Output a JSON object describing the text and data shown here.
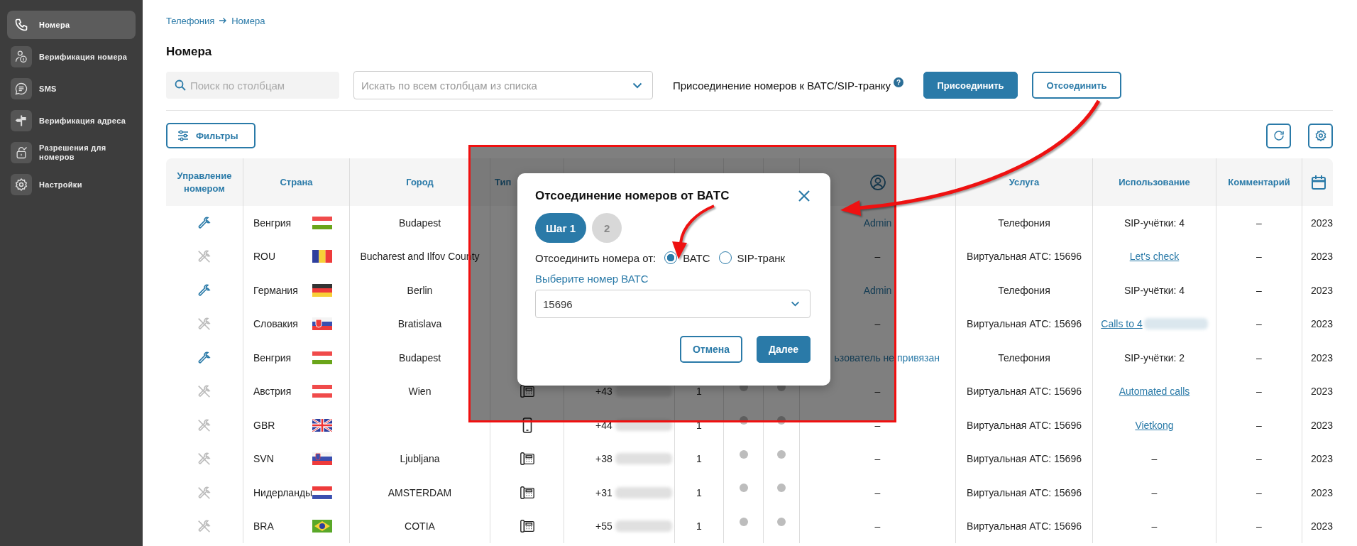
{
  "sidebar": {
    "items": [
      {
        "label": "Номера",
        "selected": true
      },
      {
        "label": "Верификация номера",
        "selected": false
      },
      {
        "label": "SMS",
        "selected": false
      },
      {
        "label": "Верификация адреса",
        "selected": false
      },
      {
        "label": "Разрешения для номеров",
        "selected": false
      },
      {
        "label": "Настройки",
        "selected": false
      }
    ]
  },
  "breadcrumb": [
    "Телефония",
    "Номера"
  ],
  "title": "Номера",
  "toolbar": {
    "search": {
      "placeholder": "Поиск по столбцам"
    },
    "column_select": {
      "placeholder": "Искать по всем столбцам из списка"
    },
    "connect_label": "Присоединение номеров к ВАТС/SIP-транку",
    "help": "?",
    "buttons": [
      {
        "label": "Присоединить",
        "kind": "primary"
      },
      {
        "label": "Отсоединить",
        "kind": "outline"
      }
    ],
    "filters": "Фильтры"
  },
  "table": {
    "columns": [
      {
        "kind": "text",
        "label": "Управление номером"
      },
      {
        "kind": "text",
        "label": "Страна"
      },
      {
        "kind": "text",
        "label": "Город"
      },
      {
        "kind": "text",
        "label": "Тип"
      },
      {
        "kind": "covered"
      },
      {
        "kind": "covered"
      },
      {
        "kind": "covered"
      },
      {
        "kind": "covered"
      },
      {
        "kind": "user-icon"
      },
      {
        "kind": "text",
        "label": "Услуга"
      },
      {
        "kind": "text",
        "label": "Использование"
      },
      {
        "kind": "text",
        "label": "Комментарий"
      },
      {
        "kind": "calendar-icon"
      }
    ],
    "rows": [
      {
        "manageable": true,
        "country": "Венгрия",
        "city": "Budapest",
        "user": {
          "text": "Admin",
          "kind": "link",
          "cut": false
        },
        "service": "Телефония",
        "usage": {
          "text": "SIP-учётки: 4",
          "kind": "plain"
        },
        "comment": "–",
        "date": "2023"
      },
      {
        "manageable": false,
        "country": "ROU",
        "city": "Bucharest and Ilfov County",
        "user": {
          "text": "–",
          "kind": "plain",
          "cut": false
        },
        "service": "Виртуальная АТС: 15696",
        "usage": {
          "text": "Let's check",
          "kind": "link"
        },
        "comment": "–",
        "date": "2023"
      },
      {
        "manageable": true,
        "country": "Германия",
        "city": "Berlin",
        "user": {
          "text": "Admin",
          "kind": "link",
          "cut": false
        },
        "service": "Телефония",
        "usage": {
          "text": "SIP-учётки: 4",
          "kind": "plain"
        },
        "comment": "–",
        "date": "2023"
      },
      {
        "manageable": false,
        "country": "Словакия",
        "city": "Bratislava",
        "user": {
          "text": "–",
          "kind": "plain",
          "cut": false
        },
        "service": "Виртуальная АТС: 15696",
        "usage": {
          "text": "Calls to 4",
          "kind": "link",
          "blurred": true
        },
        "comment": "–",
        "date": "2023"
      },
      {
        "manageable": true,
        "country": "Венгрия",
        "city": "Budapest",
        "user": {
          "text": "ьзователь не привязан",
          "kind": "link",
          "cut": true
        },
        "service": "Телефония",
        "usage": {
          "text": "SIP-учётки: 2",
          "kind": "plain"
        },
        "comment": "–",
        "date": "2023"
      },
      {
        "manageable": false,
        "country": "Австрия",
        "city": "Wien",
        "kind": "desk",
        "number": "+43",
        "number_blurred": true,
        "count": "1",
        "status_1": false,
        "status_2": false,
        "user": {
          "text": "–",
          "kind": "plain",
          "cut": false
        },
        "service": "Виртуальная АТС: 15696",
        "usage": {
          "text": "Automated calls",
          "kind": "link"
        },
        "comment": "–",
        "date": "2023"
      },
      {
        "manageable": false,
        "country": "GBR",
        "kind": "mobile",
        "number": "+44",
        "number_blurred": true,
        "count": "1",
        "status_1": false,
        "status_2": false,
        "user": {
          "text": "–",
          "kind": "plain",
          "cut": false
        },
        "service": "Виртуальная АТС: 15696",
        "usage": {
          "text": "Vietkong",
          "kind": "link"
        },
        "comment": "–",
        "date": "2023"
      },
      {
        "manageable": false,
        "country": "SVN",
        "city": "Ljubljana",
        "kind": "desk",
        "number": "+38",
        "number_blurred": true,
        "count": "1",
        "status_1": false,
        "status_2": false,
        "user": {
          "text": "–",
          "kind": "plain",
          "cut": false
        },
        "service": "Виртуальная АТС: 15696",
        "usage": {
          "text": "–",
          "kind": "plain"
        },
        "comment": "–",
        "date": "2023"
      },
      {
        "manageable": false,
        "country": "Нидерланды",
        "city": "AMSTERDAM",
        "kind": "desk",
        "number": "+31",
        "number_blurred": true,
        "count": "1",
        "status_1": false,
        "status_2": false,
        "user": {
          "text": "–",
          "kind": "plain",
          "cut": false
        },
        "service": "Виртуальная АТС: 15696",
        "usage": {
          "text": "–",
          "kind": "plain"
        },
        "comment": "–",
        "date": "2023"
      },
      {
        "manageable": false,
        "country": "BRA",
        "city": "COTIA",
        "kind": "desk",
        "number": "+55",
        "number_blurred": true,
        "count": "1",
        "status_1": false,
        "status_2": false,
        "user": {
          "text": "–",
          "kind": "plain",
          "cut": false
        },
        "service": "Виртуальная АТС: 15696",
        "usage": {
          "text": "–",
          "kind": "plain"
        },
        "comment": "–",
        "date": "2023"
      }
    ]
  },
  "dialog": {
    "title": "Отсоединение номеров от ВАТС",
    "steps": [
      {
        "label": "Шаг 1",
        "selected": true
      },
      {
        "label": "2",
        "selected": false
      }
    ],
    "source_label": "Отсоединить номера от:",
    "options": [
      {
        "label": "ВАТС",
        "selected": true
      },
      {
        "label": "SIP-транк",
        "selected": false
      }
    ],
    "pbx_label": "Выберите номер ВАТС",
    "pbx_value": "15696",
    "buttons": [
      {
        "label": "Отмена",
        "kind": "outline"
      },
      {
        "label": "Далее",
        "kind": "primary"
      }
    ]
  }
}
